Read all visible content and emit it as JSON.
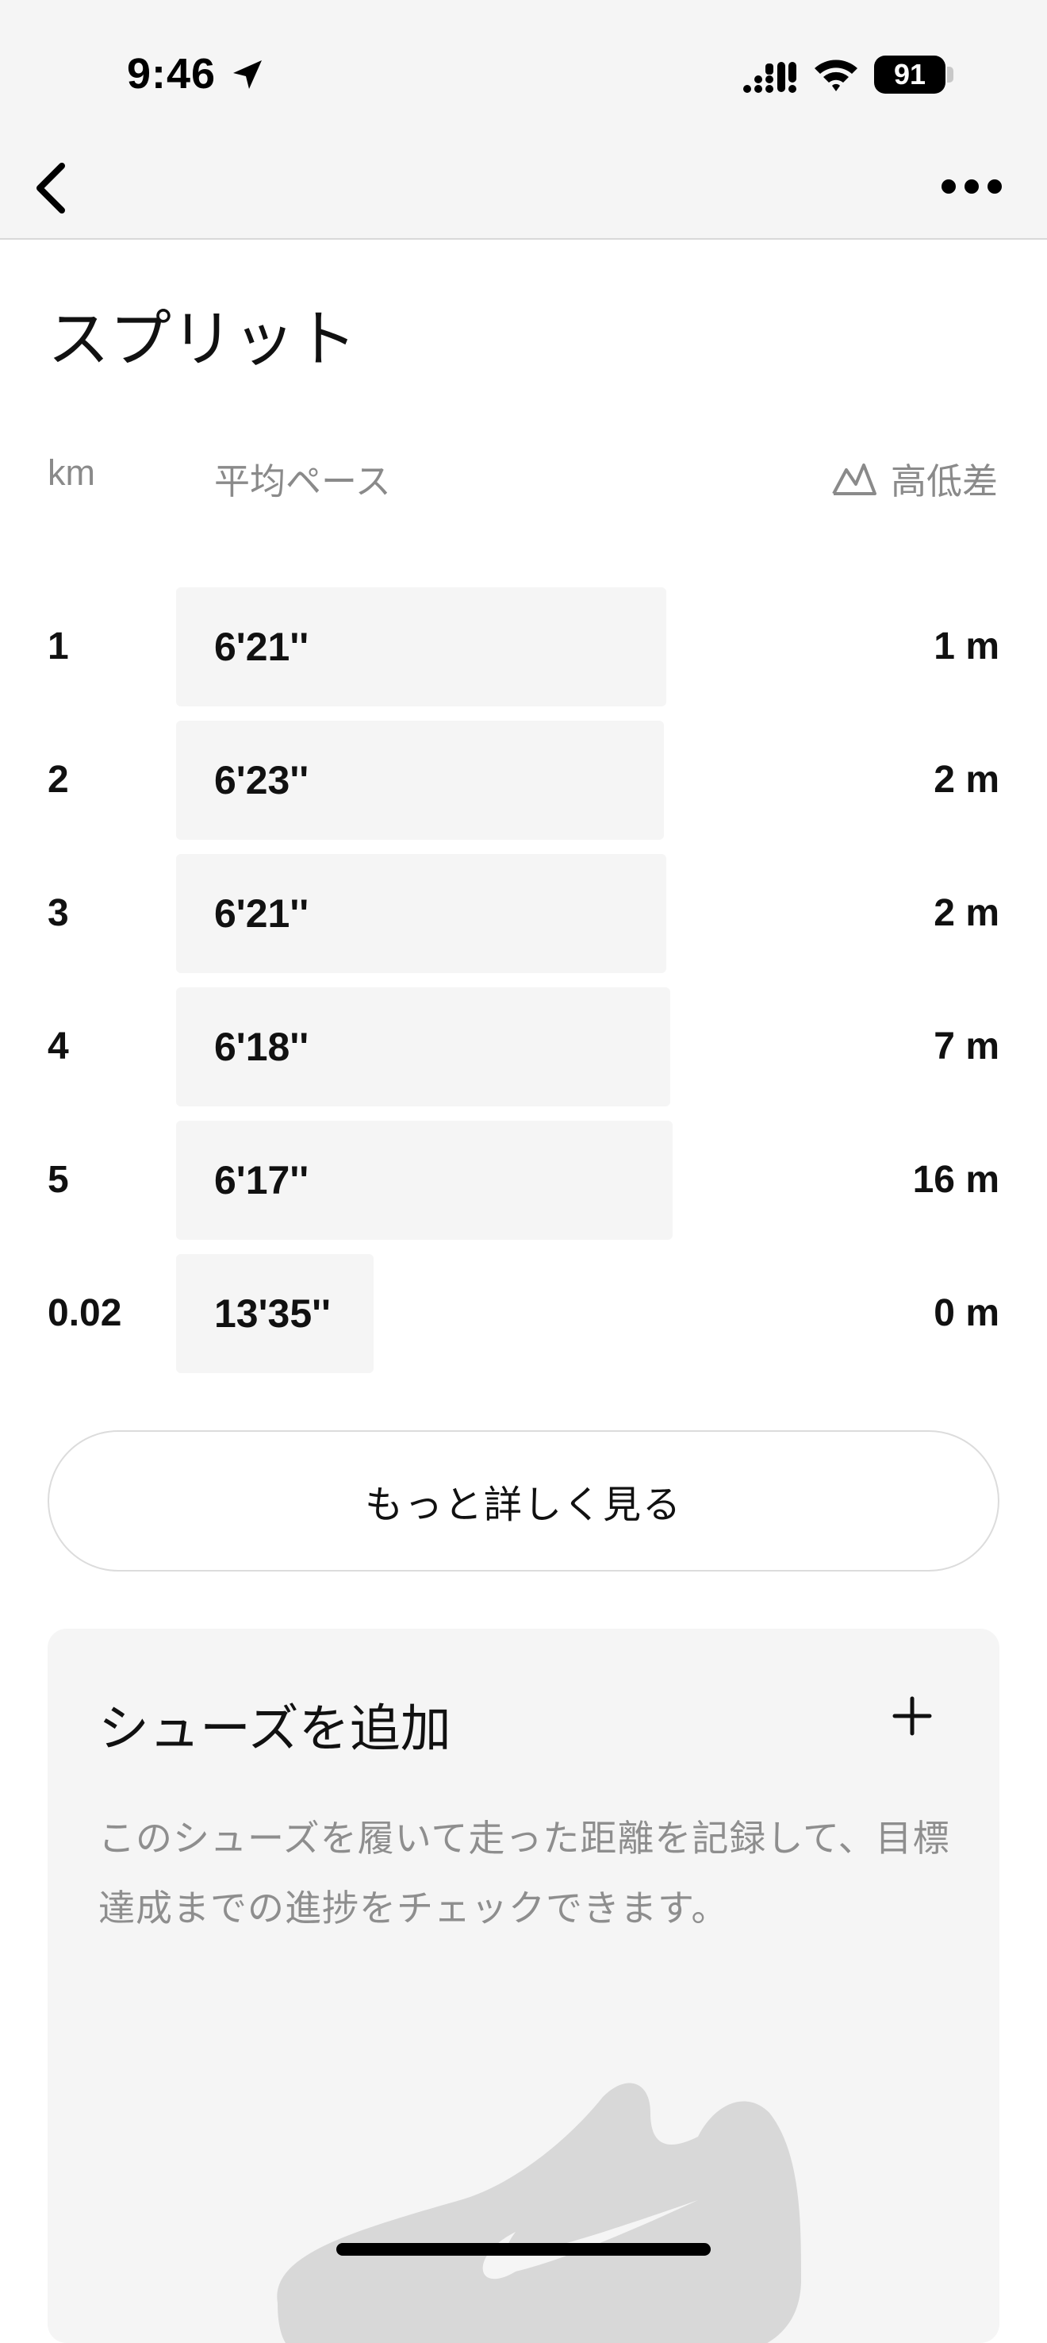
{
  "status_bar": {
    "time": "9:46",
    "battery": "91"
  },
  "nav": {
    "back_icon": "chevron-left-icon",
    "more_icon": "ellipsis-icon"
  },
  "title": "スプリット",
  "table": {
    "headers": {
      "km": "km",
      "pace": "平均ペース",
      "elevation": "高低差"
    },
    "rows": [
      {
        "km": "1",
        "pace": "6'21''",
        "elevation": "1 m",
        "bar_fraction": 0.468
      },
      {
        "km": "2",
        "pace": "6'23''",
        "elevation": "2 m",
        "bar_fraction": 0.466
      },
      {
        "km": "3",
        "pace": "6'21''",
        "elevation": "2 m",
        "bar_fraction": 0.468
      },
      {
        "km": "4",
        "pace": "6'18''",
        "elevation": "7 m",
        "bar_fraction": 0.472
      },
      {
        "km": "5",
        "pace": "6'17''",
        "elevation": "16 m",
        "bar_fraction": 0.474
      },
      {
        "km": "0.02",
        "pace": "13'35''",
        "elevation": "0 m",
        "bar_fraction": 0.189
      }
    ]
  },
  "more_button": "もっと詳しく見る",
  "shoe_card": {
    "title": "シューズを追加",
    "description": "このシューズを履いて走った距離を記録して、目標達成までの進捗をチェックできます。"
  },
  "colors": {
    "bar_bg": "#f5f5f5",
    "muted_text": "#8a8a8a",
    "text": "#111111"
  }
}
